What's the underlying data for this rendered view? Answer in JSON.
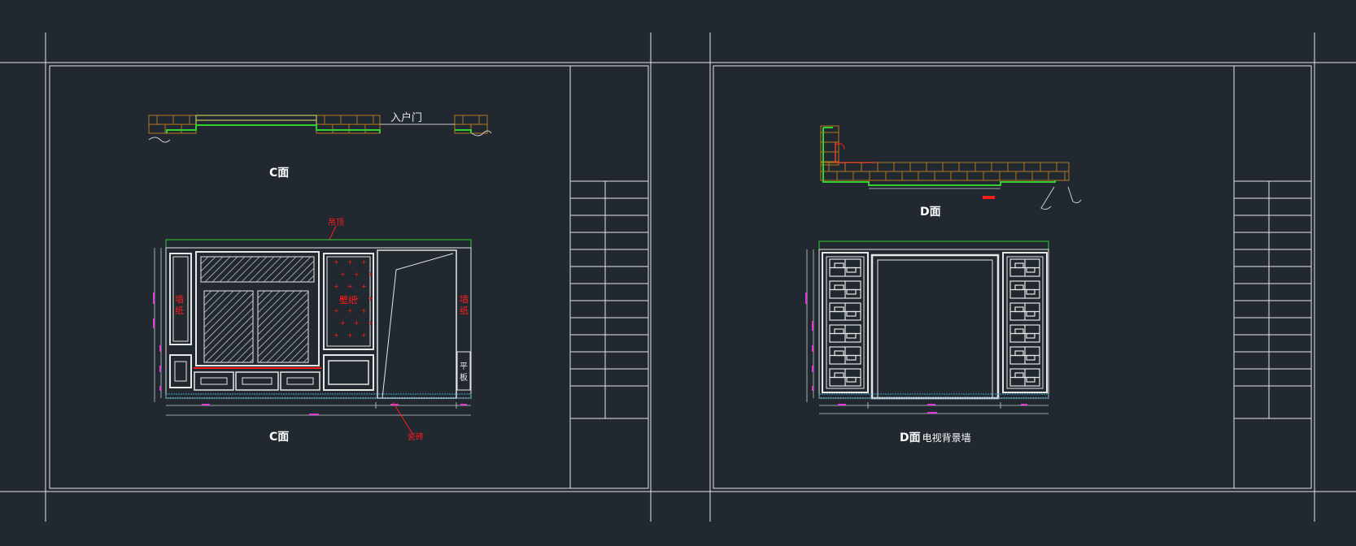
{
  "colors": {
    "background": "#212830",
    "frame": "#e6e6e6",
    "dim": "#cccccc",
    "wall_hatch": "#b5781e",
    "finish_green": "#2fd02f",
    "yellow": "#e7e06a",
    "red_label": "#ff1c1c",
    "magenta_dim": "#e03bd8",
    "cyan_floor": "#3fa7c9"
  },
  "sheet_left": {
    "plan": {
      "door_label": "入户门",
      "caption": "C面"
    },
    "elevation": {
      "ceiling_label": "吊顶",
      "wallpaper_left": "墙\n纸",
      "wallpaper_center": "壁纸",
      "wallpaper_right": "墙\n纸",
      "flat_panel": "平\n板",
      "floor_label": "瓷砖",
      "caption": "C面"
    }
  },
  "sheet_right": {
    "plan": {
      "caption": "D面"
    },
    "elevation": {
      "caption_main": "D面",
      "caption_sub": "电视背景墙"
    }
  }
}
